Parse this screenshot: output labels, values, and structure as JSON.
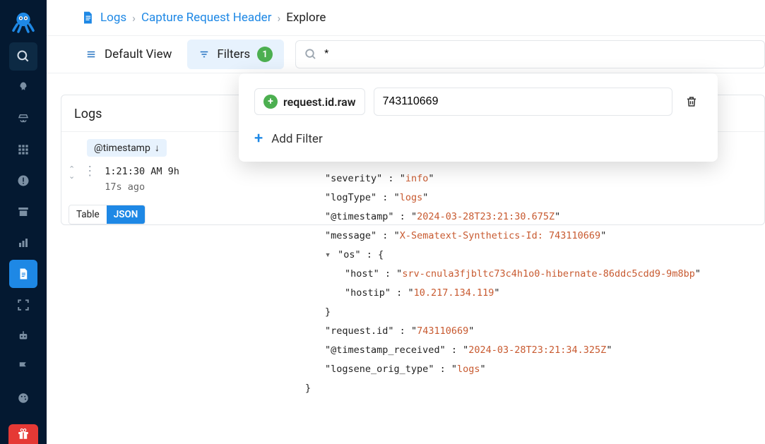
{
  "breadcrumb": {
    "root": "Logs",
    "mid": "Capture Request Header",
    "current": "Explore"
  },
  "toolbar": {
    "view_label": "Default View",
    "filters_label": "Filters",
    "filters_count": "1",
    "search_value": "*"
  },
  "filters_panel": {
    "field_name": "request.id.raw",
    "value": "743110669",
    "add_label": "Add Filter"
  },
  "logs_panel": {
    "title": "Logs",
    "timestamp_chip": "@timestamp",
    "entry_time": "1:21:30 AM 9h",
    "entry_relative": "17s ago",
    "view_table": "Table",
    "view_json": "JSON"
  },
  "json": {
    "severity_key": "severity",
    "severity_val": "info",
    "logType_key": "logType",
    "logType_val": "logs",
    "ts_key": "@timestamp",
    "ts_val": "2024-03-28T23:21:30.675Z",
    "message_key": "message",
    "message_val": "X-Sematext-Synthetics-Id: 743110669",
    "os_key": "os",
    "host_key": "host",
    "host_val": "srv-cnula3fjbltc73c4h1o0-hibernate-86ddc5cdd9-9m8bp",
    "hostip_key": "hostip",
    "hostip_val": "10.217.134.119",
    "reqid_key": "request.id",
    "reqid_val": "743110669",
    "tsrecv_key": "@timestamp_received",
    "tsrecv_val": "2024-03-28T23:21:34.325Z",
    "origtype_key": "logsene_orig_type",
    "origtype_val": "logs"
  }
}
